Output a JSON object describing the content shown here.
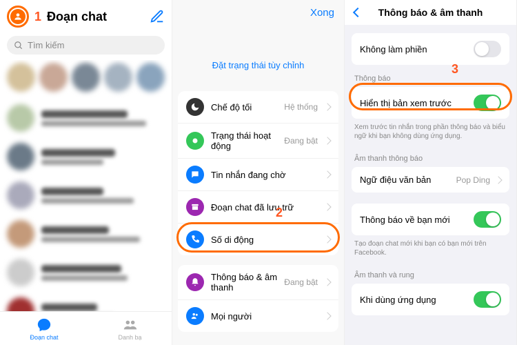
{
  "steps": {
    "one": "1",
    "two": "2",
    "three": "3"
  },
  "screen1": {
    "title": "Đoạn chat",
    "search_placeholder": "Tìm kiếm",
    "tabs": {
      "chats": "Đoạn chat",
      "contacts": "Danh bạ"
    }
  },
  "screen2": {
    "done": "Xong",
    "custom_status": "Đặt trạng thái tùy chỉnh",
    "rows": [
      {
        "label": "Chế độ tối",
        "value": "Hệ thống",
        "icon": "moon",
        "color": "#333"
      },
      {
        "label": "Trạng thái hoạt động",
        "value": "Đang bật",
        "icon": "dot",
        "color": "#34c759"
      },
      {
        "label": "Tin nhắn đang chờ",
        "value": "",
        "icon": "chat",
        "color": "#0a7cff"
      },
      {
        "label": "Đoạn chat đã lưu trữ",
        "value": "",
        "icon": "archive",
        "color": "#9c27b0"
      },
      {
        "label": "Số di động",
        "value": "",
        "icon": "phone",
        "color": "#0a7cff"
      }
    ],
    "rows2": [
      {
        "label": "Thông báo & âm thanh",
        "value": "Đang bật",
        "icon": "bell",
        "color": "#9c27b0"
      },
      {
        "label": "Mọi người",
        "value": "",
        "icon": "people",
        "color": "#0a7cff"
      }
    ]
  },
  "screen3": {
    "title": "Thông báo & âm thanh",
    "dnd_label": "Không làm phiền",
    "sec_notif": "Thông báo",
    "preview_label": "Hiển thị bản xem trước",
    "preview_help": "Xem trước tin nhắn trong phần thông báo và biểu ngữ khi bạn không dùng ứng dụng.",
    "sec_sound": "Âm thanh thông báo",
    "tone_label": "Ngữ điệu văn bản",
    "tone_value": "Pop Ding",
    "new_friend_label": "Thông báo về bạn mới",
    "new_friend_help": "Tạo đoạn chat mới khi bạn có bạn mới trên Facebook.",
    "sec_vibrate": "Âm thanh và rung",
    "in_app_label": "Khi dùng ứng dụng"
  }
}
